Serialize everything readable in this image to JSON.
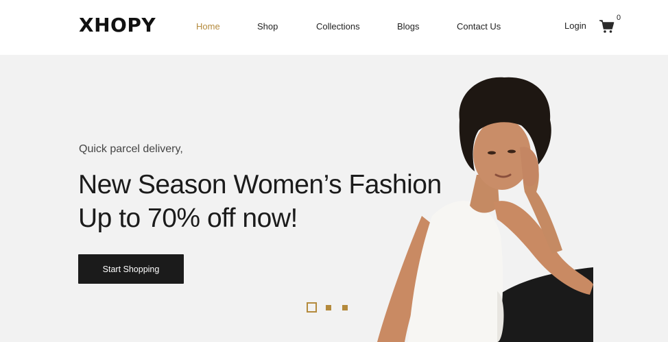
{
  "header": {
    "logo": "XHOPY",
    "nav": [
      {
        "label": "Home",
        "active": true
      },
      {
        "label": "Shop",
        "active": false
      },
      {
        "label": "Collections",
        "active": false
      },
      {
        "label": "Blogs",
        "active": false
      },
      {
        "label": "Contact Us",
        "active": false
      }
    ],
    "login_label": "Login",
    "cart_count": "0"
  },
  "hero": {
    "tagline": "Quick parcel delivery,",
    "headline_line1": "New Season Women’s Fashion",
    "headline_line2": "Up to 70% off now!",
    "cta_label": "Start Shopping",
    "slides": {
      "count": 3,
      "active_index": 0
    }
  },
  "colors": {
    "accent": "#b48a3c",
    "hero_background": "#f2f2f2",
    "button_background": "#1b1b1b"
  },
  "icons": [
    "cart-icon"
  ]
}
